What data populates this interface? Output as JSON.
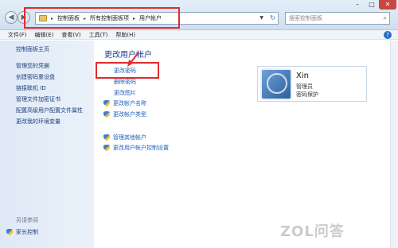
{
  "address_bar": {
    "crumbs": [
      "控制面板",
      "所有控制面板项",
      "用户帐户"
    ],
    "separator": "▸"
  },
  "search": {
    "placeholder": "搜索控制面板"
  },
  "menu": {
    "items": [
      "文件(F)",
      "编辑(E)",
      "查看(V)",
      "工具(T)",
      "帮助(H)"
    ]
  },
  "left_pane": {
    "home": "控制面板主页",
    "links": [
      "管理您的凭据",
      "创建密码重设盘",
      "链接联机 ID",
      "管理文件加密证书",
      "配置高级用户配置文件属性",
      "更改我的环境变量"
    ],
    "see_also": "另请参阅",
    "family": "家长控制"
  },
  "main": {
    "title": "更改用户帐户",
    "tasks": [
      "更改密码",
      "删除密码",
      "更改图片"
    ],
    "shield_tasks": [
      "更改帐户名称",
      "更改帐户类型"
    ],
    "other_tasks": [
      "管理其他帐户",
      "更改用户帐户控制设置"
    ]
  },
  "account": {
    "name": "Xin",
    "role": "管理员",
    "password_state": "密码保护"
  },
  "watermark": "ZOL问答",
  "colors": {
    "highlight": "#e32b2b",
    "link": "#1d5fb8",
    "title": "#1e3c8a"
  }
}
